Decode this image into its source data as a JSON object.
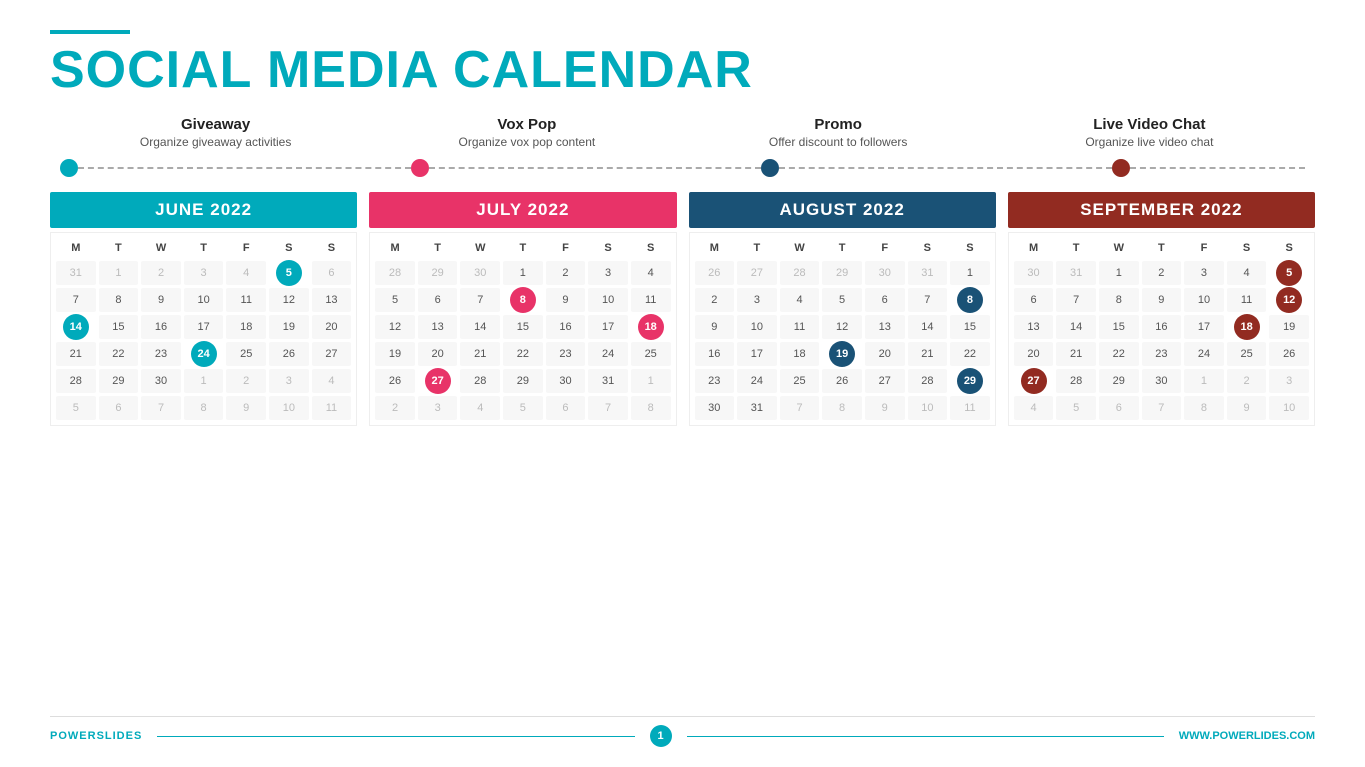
{
  "header": {
    "line_color": "#00aabb",
    "title_black": "SOCIAL MEDIA",
    "title_cyan": "CALENDAR"
  },
  "categories": [
    {
      "name": "Giveaway",
      "desc": "Organize giveaway activities"
    },
    {
      "name": "Vox Pop",
      "desc": "Organize vox pop content"
    },
    {
      "name": "Promo",
      "desc": "Offer discount to followers"
    },
    {
      "name": "Live Video Chat",
      "desc": "Organize live video chat"
    }
  ],
  "timeline": {
    "dots": [
      "blue",
      "pink",
      "dark-blue",
      "dark-red"
    ]
  },
  "calendars": [
    {
      "id": "june",
      "month": "JUNE 2022",
      "color_class": "cal-june",
      "highlight_class": "highlighted-blue",
      "days_header": [
        "M",
        "T",
        "W",
        "T",
        "F",
        "S",
        "S"
      ],
      "weeks": [
        [
          "31",
          "1",
          "2",
          "3",
          "4",
          "5",
          "6"
        ],
        [
          "7",
          "8",
          "9",
          "10",
          "11",
          "12",
          "13"
        ],
        [
          "14",
          "15",
          "16",
          "17",
          "18",
          "19",
          "20"
        ],
        [
          "21",
          "22",
          "23",
          "24",
          "25",
          "26",
          "27"
        ],
        [
          "28",
          "29",
          "30",
          "1",
          "2",
          "3",
          "4"
        ],
        [
          "5",
          "6",
          "7",
          "8",
          "9",
          "10",
          "11"
        ]
      ],
      "faded": [
        "31",
        "1",
        "2",
        "3",
        "4",
        "11"
      ],
      "highlighted_blue": [
        "5",
        "14",
        "24"
      ],
      "highlighted_pink": []
    },
    {
      "id": "july",
      "month": "JULY 2022",
      "color_class": "cal-july",
      "highlight_class": "highlighted-pink",
      "days_header": [
        "M",
        "T",
        "W",
        "T",
        "F",
        "S",
        "S"
      ],
      "weeks": [
        [
          "28",
          "29",
          "30",
          "1",
          "2",
          "3",
          "4"
        ],
        [
          "5",
          "6",
          "7",
          "8",
          "9",
          "10",
          "11"
        ],
        [
          "12",
          "13",
          "14",
          "15",
          "16",
          "17",
          "18"
        ],
        [
          "19",
          "20",
          "21",
          "22",
          "23",
          "24",
          "25"
        ],
        [
          "26",
          "27",
          "28",
          "29",
          "30",
          "31",
          "1"
        ],
        [
          "2",
          "3",
          "4",
          "5",
          "6",
          "7",
          "8"
        ]
      ],
      "faded": [
        "28",
        "29",
        "30",
        "1",
        "2"
      ],
      "highlighted_blue": [],
      "highlighted_pink": [
        "8",
        "18",
        "27"
      ]
    },
    {
      "id": "august",
      "month": "AUGUST 2022",
      "color_class": "cal-august",
      "highlight_class": "highlighted-dark-blue",
      "days_header": [
        "M",
        "T",
        "W",
        "T",
        "F",
        "S",
        "S"
      ],
      "weeks": [
        [
          "26",
          "27",
          "28",
          "29",
          "30",
          "31",
          "1"
        ],
        [
          "2",
          "3",
          "4",
          "5",
          "6",
          "7",
          "8"
        ],
        [
          "9",
          "10",
          "11",
          "12",
          "13",
          "14",
          "15"
        ],
        [
          "16",
          "17",
          "18",
          "19",
          "20",
          "21",
          "22"
        ],
        [
          "23",
          "24",
          "25",
          "26",
          "27",
          "28",
          "29"
        ],
        [
          "30",
          "31",
          "7",
          "8",
          "9",
          "10",
          "11"
        ]
      ],
      "faded": [
        "26",
        "27",
        "28",
        "29",
        "30",
        "31",
        "7",
        "8",
        "9",
        "10",
        "11"
      ],
      "highlighted_blue": [],
      "highlighted_dark_blue": [
        "8",
        "19",
        "29"
      ]
    },
    {
      "id": "september",
      "month": "SEPTEMBER 2022",
      "color_class": "cal-september",
      "highlight_class": "highlighted-dark-red",
      "days_header": [
        "M",
        "T",
        "W",
        "T",
        "F",
        "S",
        "S"
      ],
      "weeks": [
        [
          "30",
          "31",
          "1",
          "2",
          "3",
          "4",
          "5"
        ],
        [
          "6",
          "7",
          "8",
          "9",
          "10",
          "11",
          "12"
        ],
        [
          "13",
          "14",
          "15",
          "16",
          "17",
          "18",
          "19"
        ],
        [
          "20",
          "21",
          "22",
          "23",
          "24",
          "25",
          "26"
        ],
        [
          "27",
          "28",
          "29",
          "30",
          "1",
          "2",
          "3"
        ],
        [
          "4",
          "5",
          "6",
          "7",
          "8",
          "9",
          "10"
        ]
      ],
      "faded": [
        "30",
        "31",
        "1",
        "2",
        "3"
      ],
      "highlighted_dark_red": [
        "12",
        "18",
        "27"
      ]
    }
  ],
  "footer": {
    "left_black": "POWER",
    "left_cyan": "SLIDES",
    "page_number": "1",
    "right": "WWW.POWERLIDES.COM"
  }
}
